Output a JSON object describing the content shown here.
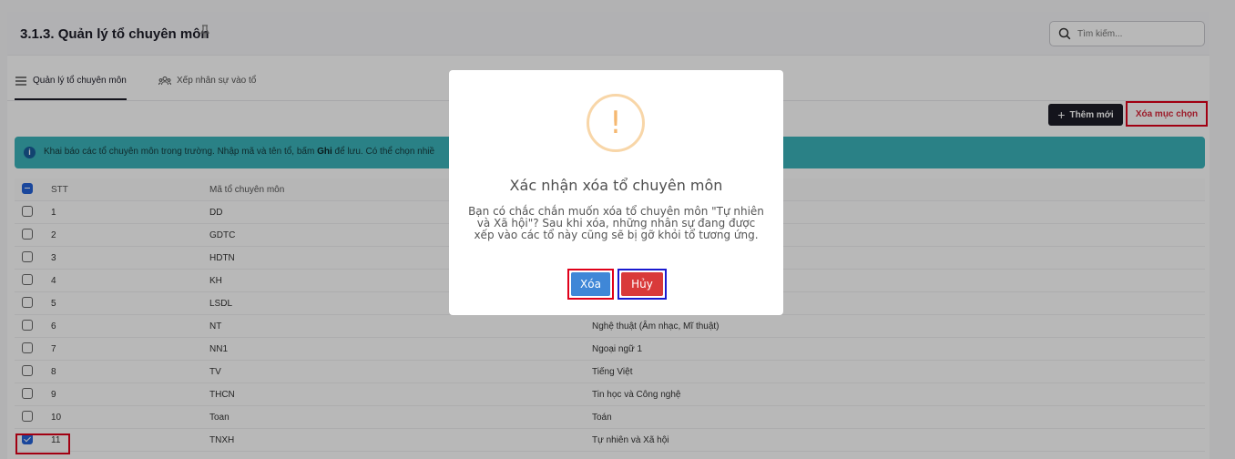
{
  "header": {
    "title": "3.1.3. Quản lý tổ chuyên môn"
  },
  "search": {
    "placeholder": "Tìm kiếm..."
  },
  "tabs": [
    {
      "label": "Quản lý tổ chuyên môn",
      "active": true
    },
    {
      "label": "Xếp nhân sự vào tổ",
      "active": false
    }
  ],
  "toolbar": {
    "add_label": "Thêm mới",
    "delete_selected_label": "Xóa mục chọn"
  },
  "info": {
    "text_before": "Khai báo các tổ chuyên môn trong trường. Nhập mã và tên tổ, bấm ",
    "text_bold": "Ghi",
    "text_after": " để lưu. Có thể chọn nhiề"
  },
  "table": {
    "headers": {
      "stt": "STT",
      "ma": "Mã tổ chuyên môn"
    },
    "rows": [
      {
        "stt": "1",
        "ma": "DD",
        "ten": "",
        "checked": false
      },
      {
        "stt": "2",
        "ma": "GDTC",
        "ten": "",
        "checked": false
      },
      {
        "stt": "3",
        "ma": "HDTN",
        "ten": "",
        "checked": false
      },
      {
        "stt": "4",
        "ma": "KH",
        "ten": "",
        "checked": false
      },
      {
        "stt": "5",
        "ma": "LSDL",
        "ten": "",
        "checked": false
      },
      {
        "stt": "6",
        "ma": "NT",
        "ten": "Nghệ thuật (Âm nhạc, Mĩ thuật)",
        "checked": false
      },
      {
        "stt": "7",
        "ma": "NN1",
        "ten": "Ngoại ngữ 1",
        "checked": false
      },
      {
        "stt": "8",
        "ma": "TV",
        "ten": "Tiếng Việt",
        "checked": false
      },
      {
        "stt": "9",
        "ma": "THCN",
        "ten": "Tin học và Công nghệ",
        "checked": false
      },
      {
        "stt": "10",
        "ma": "Toan",
        "ten": "Toán",
        "checked": false
      },
      {
        "stt": "11",
        "ma": "TNXH",
        "ten": "Tự nhiên và Xã hội",
        "checked": true
      }
    ]
  },
  "modal": {
    "icon": "!",
    "title": "Xác nhận xóa tổ chuyên môn",
    "message": "Bạn có chắc chắn muốn xóa tổ chuyên môn \"Tự nhiên và Xã hội\"? Sau khi xóa, những nhân sự đang được xếp vào các tổ này cũng sẽ bị gỡ khỏi tổ tương ứng.",
    "confirm_label": "Xóa",
    "cancel_label": "Hủy"
  },
  "colors": {
    "confirm": "#3f87d7",
    "cancel": "#d93a3a",
    "info_bar": "#3bb3ba",
    "warning": "#f5b871"
  }
}
